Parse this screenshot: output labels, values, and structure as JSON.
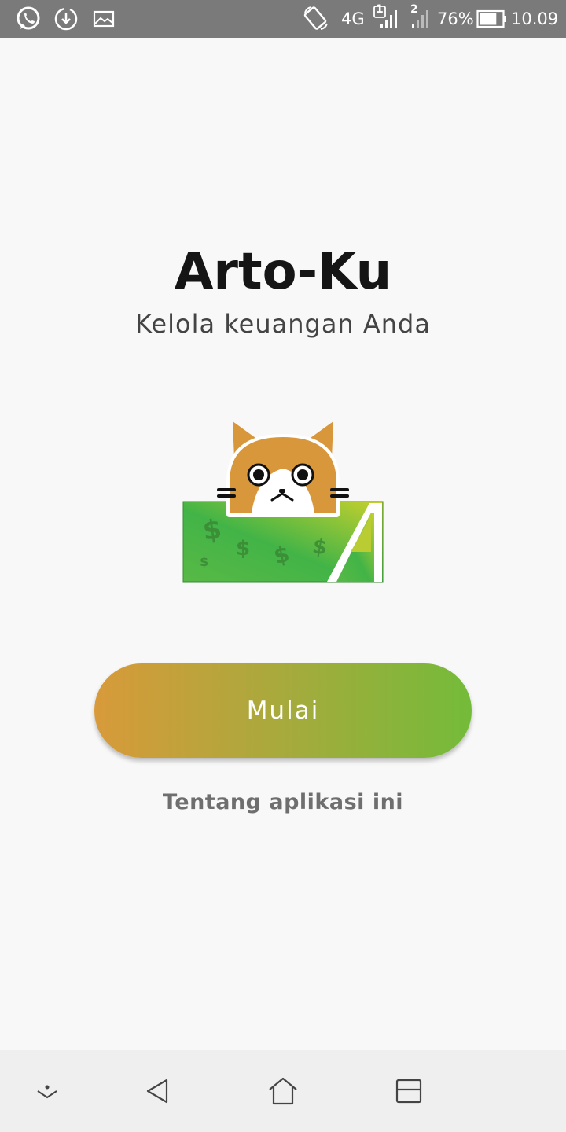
{
  "status_bar": {
    "network": "4G",
    "sim1": "1",
    "sim2": "2",
    "battery_text": "76%",
    "battery_level": 0.76,
    "time": "10.09",
    "icons": [
      "whatsapp-icon",
      "download-icon",
      "image-icon",
      "rotate-icon",
      "signal-icon",
      "battery-icon"
    ]
  },
  "app": {
    "title": "Arto-Ku",
    "subtitle": "Kelola keuangan Anda"
  },
  "actions": {
    "start_label": "Mulai",
    "about_label": "Tentang aplikasi ini"
  },
  "nav_bar": {
    "icons": [
      "hide-nav-icon",
      "back-icon",
      "home-icon",
      "recents-icon"
    ]
  },
  "colors": {
    "gradient_start": "#d89a3a",
    "gradient_end": "#74bb3a",
    "cat_orange": "#d8973b",
    "money_green": "#4cb845"
  }
}
